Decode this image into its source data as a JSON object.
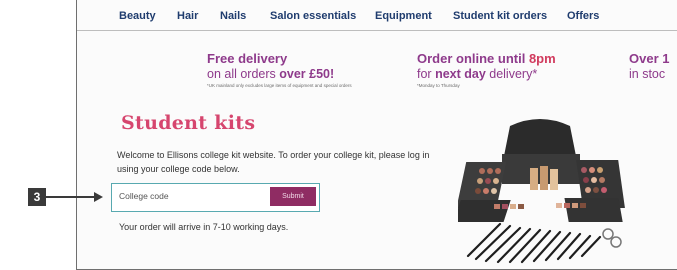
{
  "nav": {
    "items": [
      "Beauty",
      "Hair",
      "Nails",
      "Salon essentials",
      "Equipment",
      "Student kit orders",
      "Offers"
    ]
  },
  "promos": {
    "delivery": {
      "line1": "Free delivery",
      "line2_prefix": "on all orders ",
      "line2_bold": "over £50!",
      "fine_print": "*UK mainland only excludes large items of equipment and special orders"
    },
    "order_online": {
      "line1_prefix": "Order online until ",
      "line1_highlight": "8pm",
      "line2_prefix": "for ",
      "line2_bold": "next day",
      "line2_suffix": " delivery*",
      "fine_print": "*Monday to Thursday"
    },
    "stock": {
      "line1": "Over 1",
      "line2": "in stoc"
    }
  },
  "main": {
    "title": "Student kits",
    "intro": "Welcome to Ellisons college kit website. To order your college kit, please log in using your college code below.",
    "code_placeholder": "College code",
    "submit_label": "Submit",
    "delivery_note": "Your order will arrive in 7-10 working days."
  },
  "callout": {
    "number": "3"
  },
  "colors": {
    "nav_text": "#1f3c6e",
    "promo_purple": "#8e3a8b",
    "accent_pink": "#d6456e",
    "input_border": "#58a9b0",
    "submit_bg": "#8f2c63"
  }
}
